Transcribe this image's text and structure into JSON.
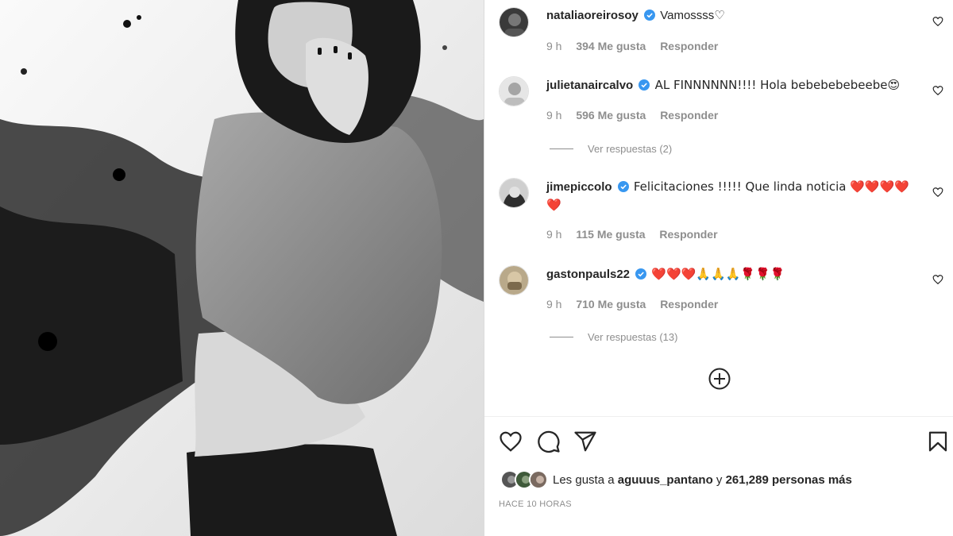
{
  "post": {
    "comments": [
      {
        "username": "nataliaoreirosoy",
        "text": "Vamossss♡",
        "time": "9 h",
        "likes": "394 Me gusta",
        "reply_label": "Responder"
      },
      {
        "username": "julietanaircalvo",
        "text": "AL FINNNNNN!!!! Hola bebebebebeebe😍",
        "time": "9 h",
        "likes": "596 Me gusta",
        "reply_label": "Responder",
        "view_replies": "Ver respuestas (2)"
      },
      {
        "username": "jimepiccolo",
        "text": "Felicitaciones !!!!! Que linda noticia ❤️❤️❤️❤️❤️",
        "time": "9 h",
        "likes": "115 Me gusta",
        "reply_label": "Responder"
      },
      {
        "username": "gastonpauls22",
        "text": "❤️❤️❤️🙏🙏🙏🌹🌹🌹",
        "time": "9 h",
        "likes": "710 Me gusta",
        "reply_label": "Responder",
        "view_replies": "Ver respuestas (13)"
      }
    ],
    "likes_summary": {
      "prefix": "Les gusta a",
      "first_user": "aguuus_pantano",
      "joiner": "y",
      "count_text": "261,289 personas más"
    },
    "timestamp": "HACE 10 HORAS"
  },
  "icons": {
    "like": "heart-icon",
    "comment": "comment-icon",
    "share": "send-icon",
    "save": "bookmark-icon",
    "load_more": "plus-circle-icon",
    "verified": "verified-badge-icon"
  },
  "colors": {
    "verified": "#3897f0",
    "muted": "#8e8e8e",
    "text": "#262626"
  }
}
